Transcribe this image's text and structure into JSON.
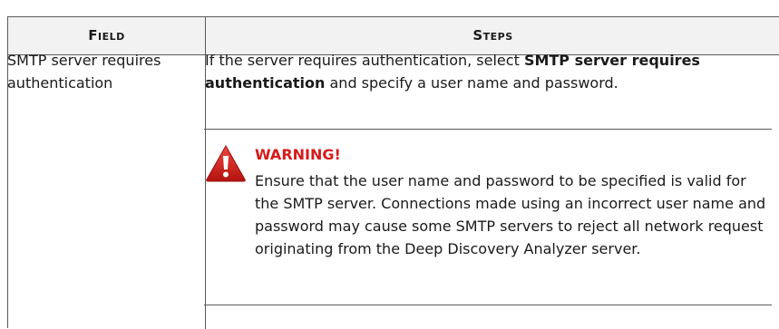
{
  "table": {
    "headers": {
      "field": "Field",
      "steps": "Steps"
    },
    "row": {
      "field": "SMTP server requires authentication",
      "steps": {
        "intro_before": "If the server requires authentication, select ",
        "intro_bold": "SMTP server requires authentication",
        "intro_after": " and specify a user name and password."
      },
      "warning": {
        "icon": "warning-triangle-icon",
        "color": "#d61a1a",
        "title": "WARNING!",
        "body": "Ensure that the user name and password to be specified is valid for the SMTP server. Connections made using an incorrect user name and password may cause some SMTP servers to reject all network request originating from the Deep Discovery Analyzer server."
      }
    }
  }
}
